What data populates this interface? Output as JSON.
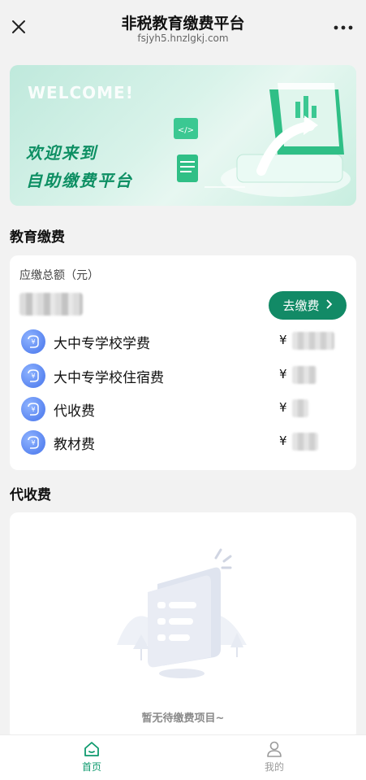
{
  "header": {
    "title": "非税教育缴费平台",
    "url": "fsjyh5.hnzlgkj.com",
    "close_icon": "close-icon",
    "more_icon": "more-dots-icon"
  },
  "banner": {
    "welcome": "WELCOME!",
    "line1": "欢迎来到",
    "line2": "自助缴费平台"
  },
  "education_fees": {
    "section_title": "教育缴费",
    "total_label": "应缴总额（元）",
    "pay_button": "去缴费",
    "currency": "¥",
    "items": [
      {
        "name": "大中专学校学费",
        "icon": "yuan-receipt-icon"
      },
      {
        "name": "大中专学校住宿费",
        "icon": "yuan-receipt-icon"
      },
      {
        "name": "代收费",
        "icon": "yuan-receipt-icon"
      },
      {
        "name": "教材费",
        "icon": "yuan-receipt-icon"
      }
    ]
  },
  "collection": {
    "section_title": "代收费",
    "empty_text": "暂无待缴费项目~"
  },
  "nav": {
    "home_label": "首页",
    "mine_label": "我的"
  },
  "colors": {
    "accent": "#128a66",
    "nav_active": "#0e9a6e",
    "icon_blue": "#5b86f1"
  }
}
